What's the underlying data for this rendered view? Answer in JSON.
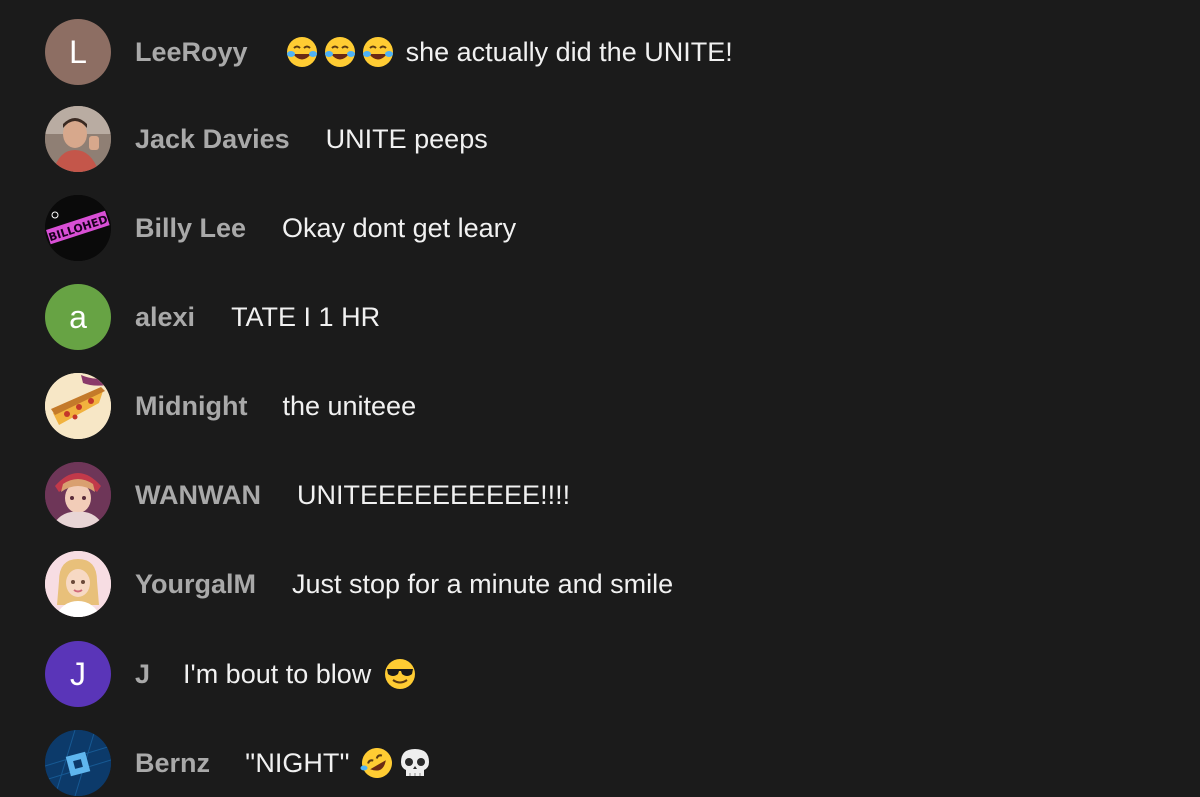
{
  "messages": [
    {
      "author": "LeeRoyy",
      "avatar_letter": "L",
      "avatar_color": "#8d6e63",
      "text": "she actually did the UNITE!",
      "emoji_before": [
        "face-with-tears-of-joy-icon",
        "face-with-tears-of-joy-icon",
        "face-with-tears-of-joy-icon"
      ]
    },
    {
      "author": "Jack Davies",
      "avatar_type": "photo",
      "text": "UNITE peeps"
    },
    {
      "author": "Billy Lee",
      "avatar_type": "logo",
      "avatar_logo_text": "BILLOHED",
      "text": "Okay dont get leary"
    },
    {
      "author": "alexi",
      "avatar_letter": "a",
      "avatar_color": "#67a344",
      "text": "TATE I 1 HR"
    },
    {
      "author": "Midnight",
      "avatar_type": "pizza",
      "text": "the uniteee"
    },
    {
      "author": "WANWAN",
      "avatar_type": "anime",
      "text": "UNITEEEEEEEEEE!!!!"
    },
    {
      "author": "YourgalM",
      "avatar_type": "doll",
      "text": "Just stop for a minute and smile"
    },
    {
      "author": "J",
      "avatar_letter": "J",
      "avatar_color": "#5a35b8",
      "text": "I'm bout to blow",
      "emoji_after": [
        "smiling-face-with-sunglasses-icon"
      ]
    },
    {
      "author": "Bernz",
      "avatar_type": "cube",
      "text": "''NIGHT''",
      "emoji_after": [
        "rolling-on-floor-laughing-icon",
        "skull-icon"
      ]
    }
  ],
  "colors": {
    "background": "#1b1b1b",
    "author": "#a9a9a9",
    "text": "#f1f1f1"
  }
}
